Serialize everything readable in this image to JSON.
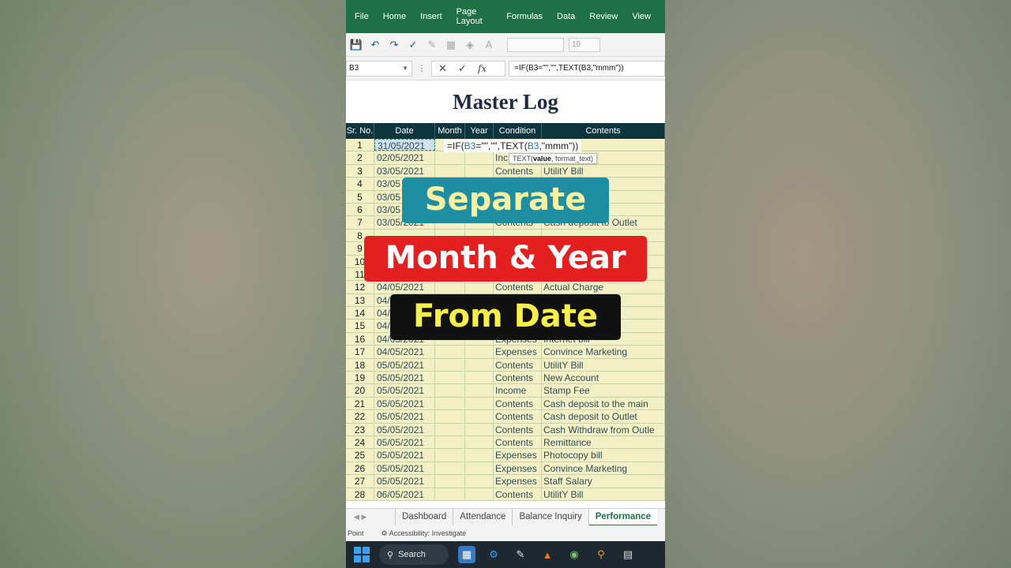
{
  "ribbon_tabs": [
    "File",
    "Home",
    "Insert",
    "Page Layout",
    "Formulas",
    "Data",
    "Review",
    "View"
  ],
  "toolbar": {
    "font_size": "10",
    "icons": [
      "save-icon",
      "undo-icon",
      "redo-icon",
      "spellcheck-icon",
      "format-painter-icon",
      "borders-icon",
      "fill-color-icon",
      "font-color-icon"
    ]
  },
  "formula_bar": {
    "name_box": "B3",
    "formula": "=IF(B3=\"\",\"\",TEXT(B3,\"mmm\"))"
  },
  "sheet": {
    "title": "Master Log",
    "headers": [
      "Sr. No.",
      "Date",
      "Month",
      "Year",
      "Condition",
      "Contents"
    ],
    "rows": [
      {
        "sr": "1",
        "date": "31/05/2021",
        "cond": "",
        "cont": ""
      },
      {
        "sr": "2",
        "date": "02/05/2021",
        "cond": "Inc",
        "cont": ""
      },
      {
        "sr": "3",
        "date": "03/05/2021",
        "cond": "Contents",
        "cont": "UtilitY Bill"
      },
      {
        "sr": "4",
        "date": "03/05",
        "cond": "",
        "cont": ""
      },
      {
        "sr": "5",
        "date": "03/05",
        "cond": "",
        "cont": ""
      },
      {
        "sr": "6",
        "date": "03/05",
        "cond": "",
        "cont": "to the main"
      },
      {
        "sr": "7",
        "date": "03/05/2021",
        "cond": "Contents",
        "cont": "Cash deposit to Outlet"
      },
      {
        "sr": "8",
        "date": "",
        "cond": "",
        "cont": ""
      },
      {
        "sr": "9",
        "date": "",
        "cond": "",
        "cont": ""
      },
      {
        "sr": "10",
        "date": "",
        "cond": "",
        "cont": ""
      },
      {
        "sr": "11",
        "date": "",
        "cond": "",
        "cont": "gh On"
      },
      {
        "sr": "12",
        "date": "04/05/2021",
        "cond": "Contents",
        "cont": "Actual Charge"
      },
      {
        "sr": "13",
        "date": "04/",
        "cond": "",
        "cont": "the main"
      },
      {
        "sr": "14",
        "date": "04/",
        "cond": "",
        "cont": "Outlet"
      },
      {
        "sr": "15",
        "date": "04/",
        "cond": "",
        "cont": ""
      },
      {
        "sr": "16",
        "date": "04/05/2021",
        "cond": "Expenses",
        "cont": "Internet bill"
      },
      {
        "sr": "17",
        "date": "04/05/2021",
        "cond": "Expenses",
        "cont": "Convince Marketing"
      },
      {
        "sr": "18",
        "date": "05/05/2021",
        "cond": "Contents",
        "cont": "UtilitY Bill"
      },
      {
        "sr": "19",
        "date": "05/05/2021",
        "cond": "Contents",
        "cont": "New Account"
      },
      {
        "sr": "20",
        "date": "05/05/2021",
        "cond": "Income",
        "cont": "Stamp Fee"
      },
      {
        "sr": "21",
        "date": "05/05/2021",
        "cond": "Contents",
        "cont": "Cash deposit to the main"
      },
      {
        "sr": "22",
        "date": "05/05/2021",
        "cond": "Contents",
        "cont": "Cash deposit to Outlet"
      },
      {
        "sr": "23",
        "date": "05/05/2021",
        "cond": "Contents",
        "cont": "Cash Withdraw from Outle"
      },
      {
        "sr": "24",
        "date": "05/05/2021",
        "cond": "Contents",
        "cont": "Remittance"
      },
      {
        "sr": "25",
        "date": "05/05/2021",
        "cond": "Expenses",
        "cont": "Photocopy bill"
      },
      {
        "sr": "26",
        "date": "05/05/2021",
        "cond": "Expenses",
        "cont": "Convince Marketing"
      },
      {
        "sr": "27",
        "date": "05/05/2021",
        "cond": "Expenses",
        "cont": "Staff Salary"
      },
      {
        "sr": "28",
        "date": "06/05/2021",
        "cond": "Contents",
        "cont": "UtilitY Bill"
      }
    ]
  },
  "cell_formula": {
    "prefix": "=IF(",
    "ref1": "B3",
    "mid": "=\"\",\"\",TEXT(",
    "ref2": "B3",
    "suffix": ",\"mmm\"))"
  },
  "tooltip": {
    "fn": "TEXT(",
    "arg": "value",
    "rest": ", format_text)"
  },
  "banners": [
    "Separate",
    "Month & Year",
    "From Date"
  ],
  "sheet_tabs": [
    "Dashboard",
    "Attendance",
    "Balance Inquiry",
    "Performance"
  ],
  "active_sheet_tab": "Performance",
  "status": {
    "mode": "Point",
    "accessibility": "Accessibility: Investigate"
  },
  "taskbar": {
    "search_label": "Search"
  }
}
